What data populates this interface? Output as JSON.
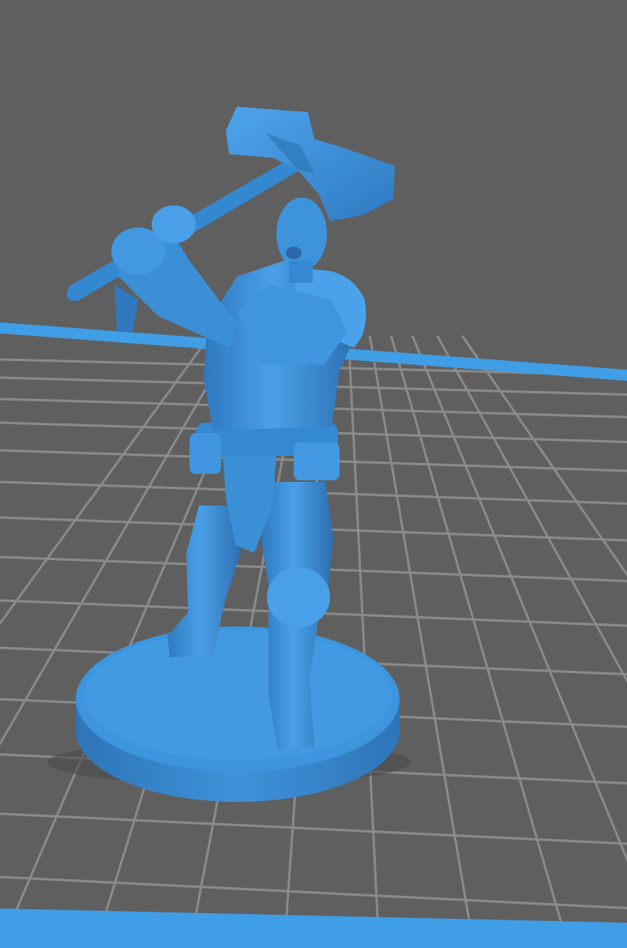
{
  "viewport": {
    "background_color": "#5f5f5f",
    "grid_color": "#8a8a8a",
    "bed_edge_color": "#3f9ee6",
    "model_color": "#3a8fd6",
    "model_shadow_color": "#2f73b2",
    "model_highlight_color": "#5aaef0"
  },
  "model": {
    "subject": "barbarian-with-double-axe",
    "has_base": true
  }
}
